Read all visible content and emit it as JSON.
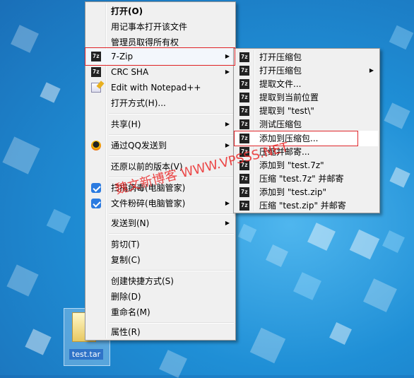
{
  "desktop": {
    "file_name": "test.tar"
  },
  "main_menu": {
    "items": [
      {
        "label": "打开(O)"
      },
      {
        "label": "用记事本打开该文件"
      },
      {
        "label": "管理员取得所有权"
      },
      {
        "label": "7-Zip"
      },
      {
        "label": "CRC SHA"
      },
      {
        "label": "Edit with Notepad++"
      },
      {
        "label": "打开方式(H)..."
      },
      {
        "label": "共享(H)"
      },
      {
        "label": "通过QQ发送到"
      },
      {
        "label": "还原以前的版本(V)"
      },
      {
        "label": "扫描病毒(电脑管家)"
      },
      {
        "label": "文件粉碎(电脑管家)"
      },
      {
        "label": "发送到(N)"
      },
      {
        "label": "剪切(T)"
      },
      {
        "label": "复制(C)"
      },
      {
        "label": "创建快捷方式(S)"
      },
      {
        "label": "删除(D)"
      },
      {
        "label": "重命名(M)"
      },
      {
        "label": "属性(R)"
      }
    ]
  },
  "sub_menu": {
    "items": [
      {
        "label": "打开压缩包"
      },
      {
        "label": "打开压缩包"
      },
      {
        "label": "提取文件..."
      },
      {
        "label": "提取到当前位置"
      },
      {
        "label": "提取到 \"test\\\""
      },
      {
        "label": "测试压缩包"
      },
      {
        "label": "添加到压缩包..."
      },
      {
        "label": "压缩并邮寄..."
      },
      {
        "label": "添加到 \"test.7z\""
      },
      {
        "label": "压缩 \"test.7z\" 并邮寄"
      },
      {
        "label": "添加到 \"test.zip\""
      },
      {
        "label": "压缩 \"test.zip\" 并邮寄"
      }
    ]
  },
  "icons": {
    "sevenzip": "7z",
    "crc": "7z",
    "notepad": "notepad-icon",
    "qq": "qq-icon",
    "shield": "shield-icon"
  },
  "watermark": "魏文新博客 WWW.VPSSS.NET",
  "colors": {
    "highlight_box": "#e0262b"
  }
}
